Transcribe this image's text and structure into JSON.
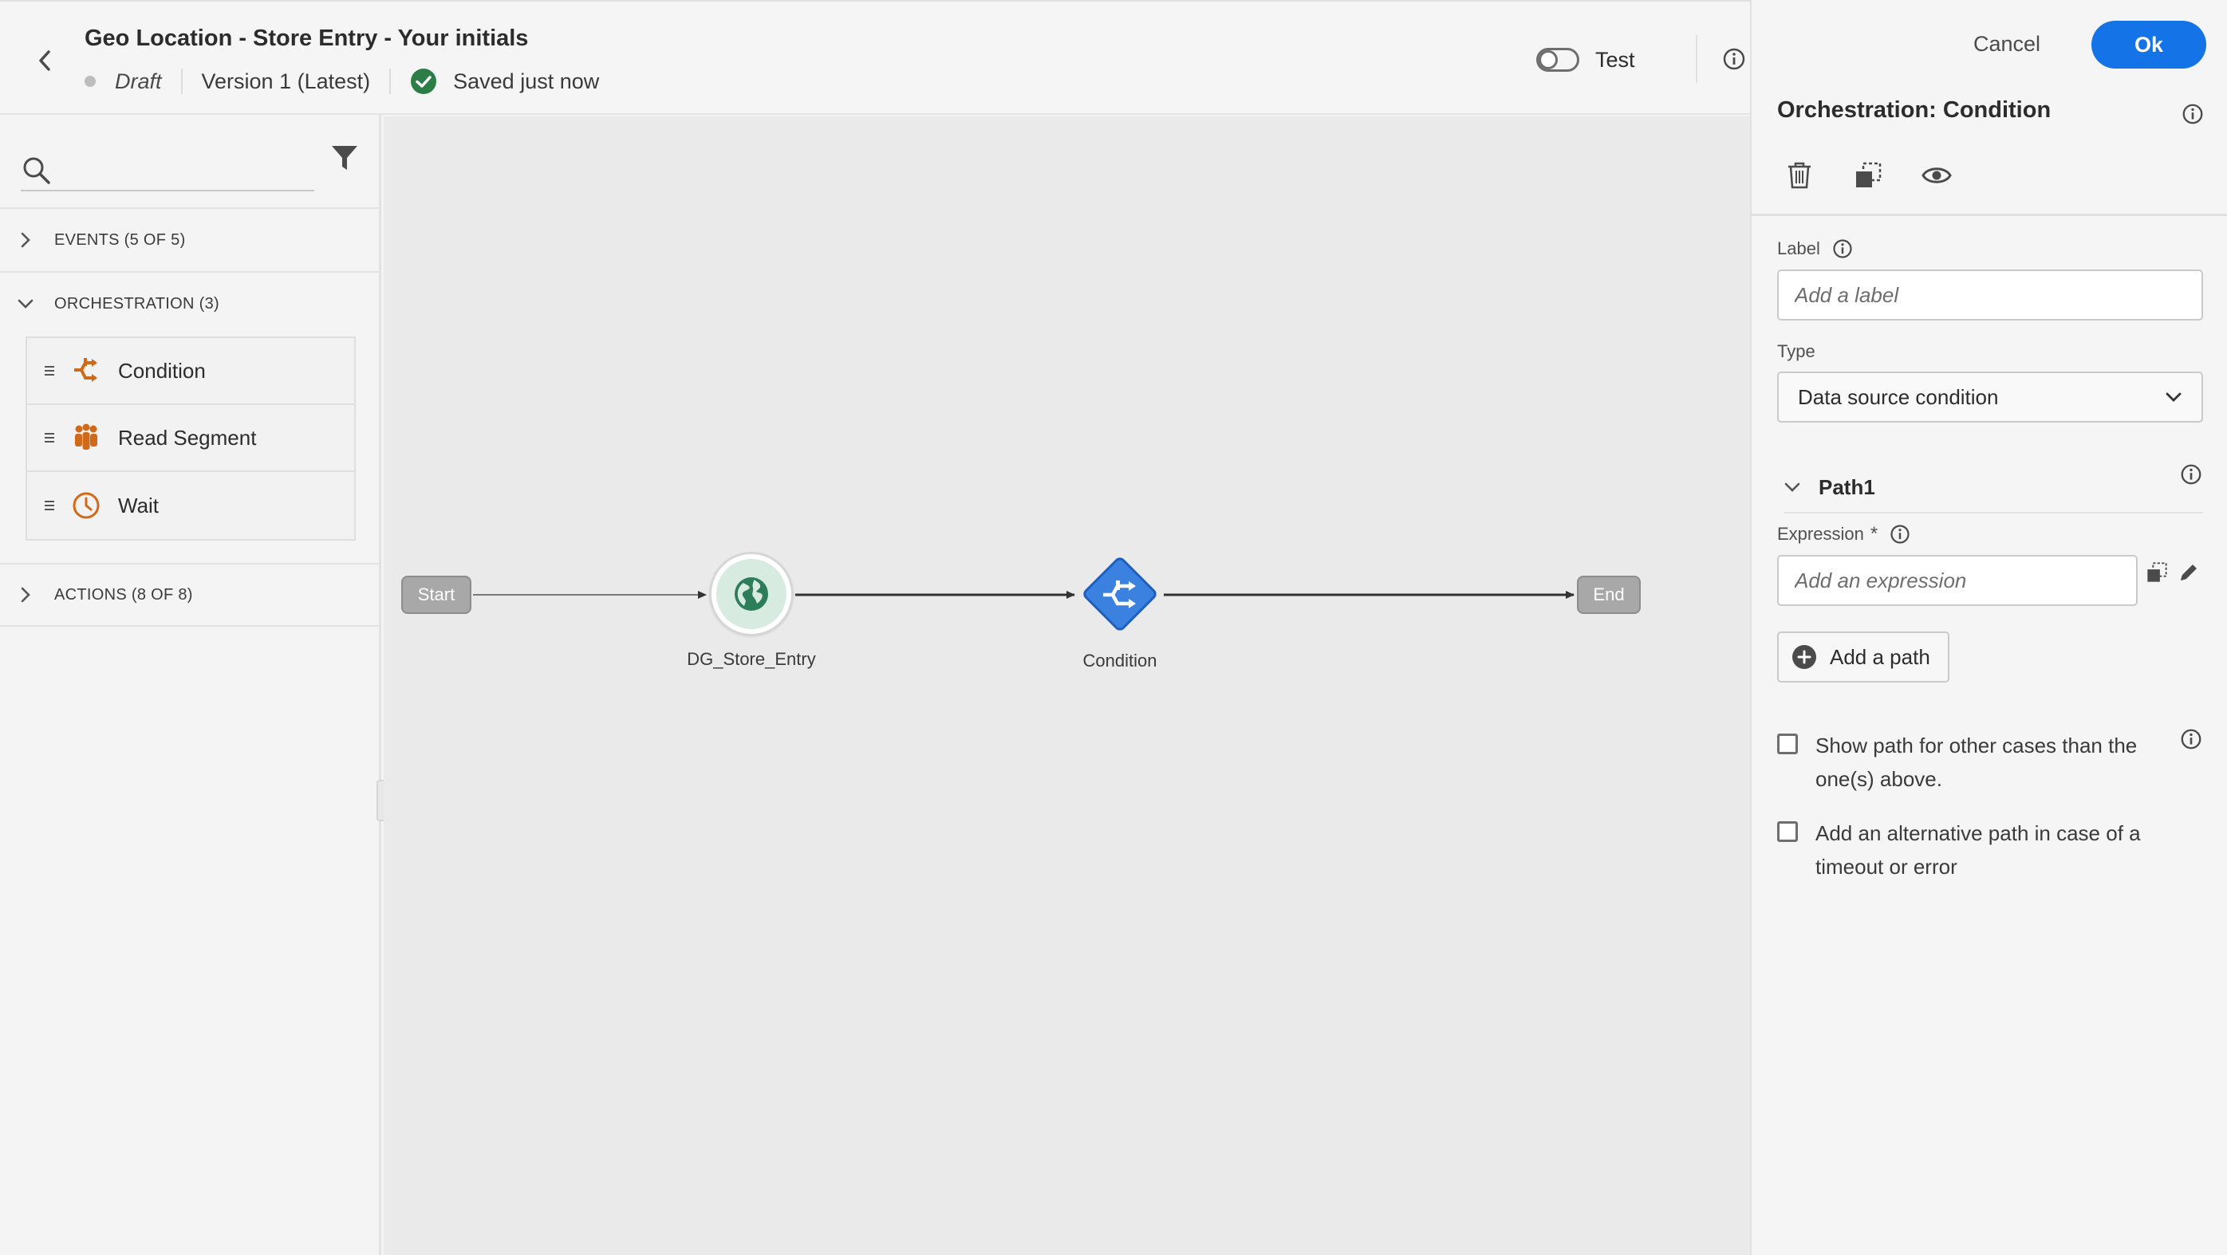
{
  "header": {
    "title": "Geo Location - Store Entry - Your initials",
    "status": "Draft",
    "version": "Version 1 (Latest)",
    "saved_text": "Saved just now",
    "test_label": "Test",
    "test_enabled": false
  },
  "left_panel": {
    "search_placeholder": "",
    "sections": {
      "events": "EVENTS (5 OF 5)",
      "orchestration": "ORCHESTRATION (3)",
      "actions": "ACTIONS (8 OF 8)"
    },
    "orchestration_items": [
      {
        "label": "Condition",
        "icon": "condition-icon"
      },
      {
        "label": "Read Segment",
        "icon": "segment-people-icon"
      },
      {
        "label": "Wait",
        "icon": "clock-icon"
      }
    ]
  },
  "canvas": {
    "start_label": "Start",
    "end_label": "End",
    "entry_node_label": "DG_Store_Entry",
    "entry_node_icon": "globe-icon",
    "condition_node_label": "Condition",
    "condition_node_icon": "condition-icon"
  },
  "right_panel": {
    "cancel_label": "Cancel",
    "ok_label": "Ok",
    "title": "Orchestration: Condition",
    "label_field": {
      "label": "Label",
      "placeholder": "Add a label",
      "value": ""
    },
    "type_field": {
      "label": "Type",
      "value": "Data source condition"
    },
    "path": {
      "title": "Path1",
      "expression_label": "Expression",
      "expression_required_mark": "*",
      "expression_placeholder": "Add an expression"
    },
    "add_path_label": "Add a path",
    "checkbox_other": {
      "label": "Show path for other cases than the one(s) above.",
      "checked": false
    },
    "checkbox_timeout": {
      "label": "Add an alternative path in case of a timeout or error",
      "checked": false
    }
  },
  "colors": {
    "accent": "#1473e6",
    "orchestration_icon": "#d06a1b",
    "condition_node": "#3b82e0",
    "entry_node_fill": "#d7ebe1",
    "entry_node_icon": "#2d7d5a",
    "saved_check": "#2d7d46"
  }
}
